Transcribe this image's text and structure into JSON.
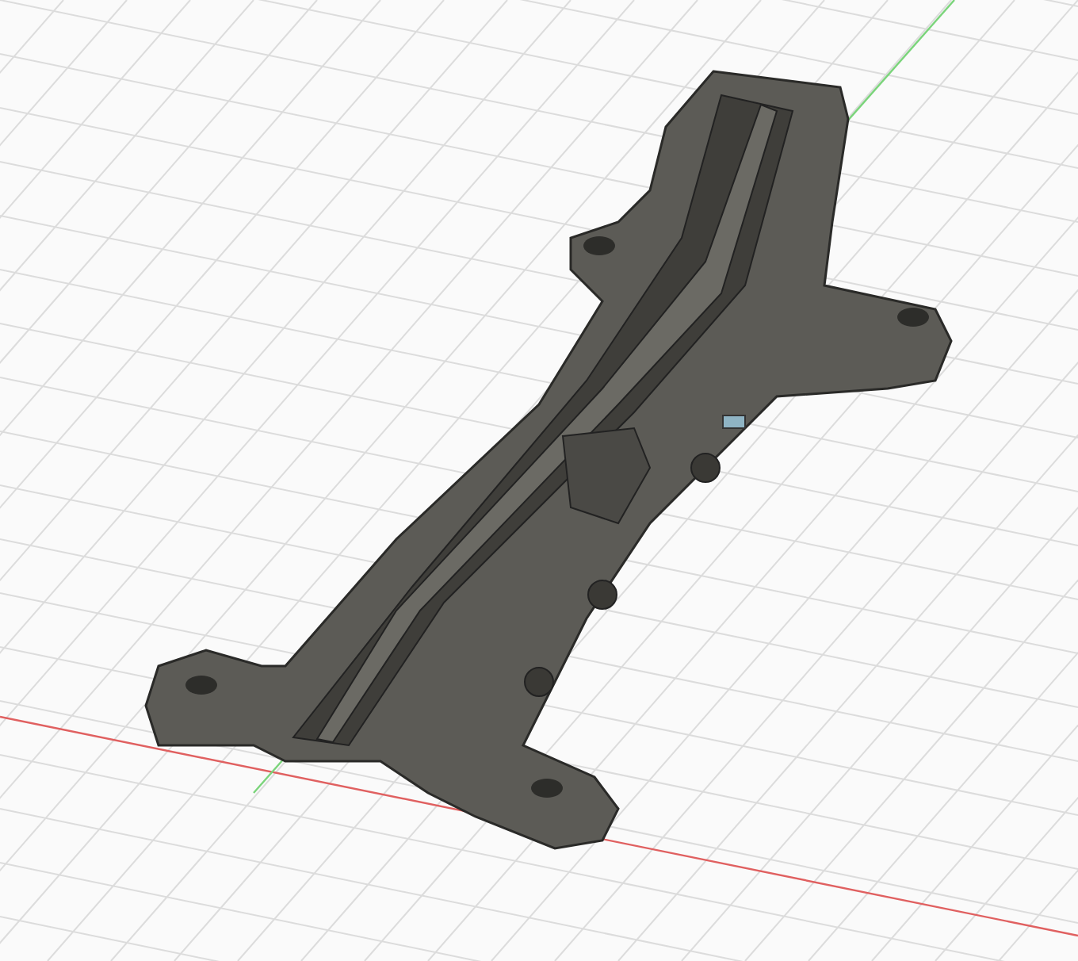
{
  "viewport": {
    "axes": [
      {
        "kind": "x",
        "color": "#e06060"
      },
      {
        "kind": "y",
        "color": "#7ad47a"
      }
    ]
  }
}
